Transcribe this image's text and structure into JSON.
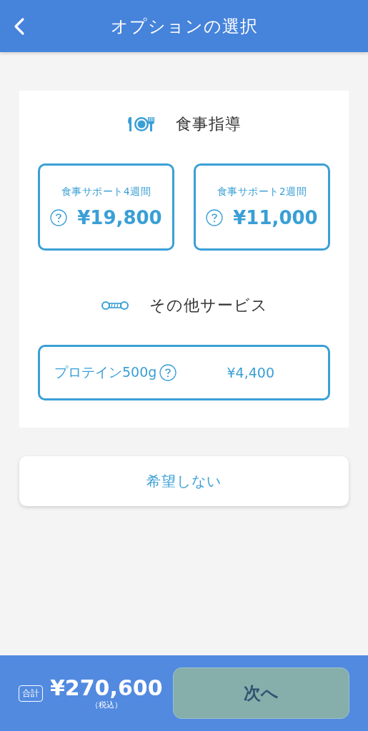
{
  "header": {
    "title": "オプションの選択"
  },
  "sections": [
    {
      "kind": "meal",
      "title": "食事指導",
      "options": [
        {
          "name": "食事サポート4週間",
          "price": "¥19,800",
          "selected": false
        },
        {
          "name": "食事サポート2週間",
          "price": "¥11,000",
          "selected": false
        }
      ]
    },
    {
      "kind": "other",
      "title": "その他サービス",
      "options": [
        {
          "name": "プロテイン500g",
          "price": "¥4,400",
          "selected": false
        }
      ]
    }
  ],
  "decline_button": "希望しない",
  "footer": {
    "total_label": "合計",
    "total": "¥270,600",
    "tax_note": "（税込）",
    "next_button": {
      "label": "次へ",
      "disabled": true
    }
  }
}
